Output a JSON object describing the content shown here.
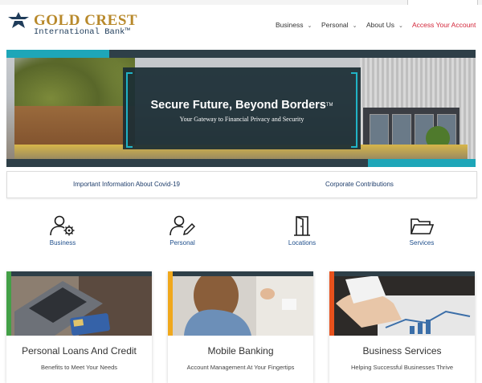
{
  "brand": {
    "name": "GOLD CREST",
    "subtitle": "International Bank™",
    "gold": "#b8892b",
    "navy": "#1f3c5a"
  },
  "nav": {
    "items": [
      {
        "label": "Business",
        "icon": "chevron-down-icon"
      },
      {
        "label": "Personal",
        "icon": "chevron-down-icon"
      },
      {
        "label": "About Us",
        "icon": "chevron-down-icon"
      }
    ],
    "cta": "Access Your Account",
    "cta_color": "#d3263a"
  },
  "hero": {
    "title": "Secure Future, Beyond Borders",
    "title_mark": "TM",
    "subtitle": "Your Gateway to Financial Privacy and Security",
    "accent": "#1ea6b8"
  },
  "info_links": [
    "Important Information About Covid-19",
    "Corporate Contributions"
  ],
  "quick_links": [
    {
      "label": "Business",
      "icon": "user-gear-icon"
    },
    {
      "label": "Personal",
      "icon": "user-edit-icon"
    },
    {
      "label": "Locations",
      "icon": "door-icon"
    },
    {
      "label": "Services",
      "icon": "folder-open-icon"
    }
  ],
  "cards": [
    {
      "title": "Personal Loans And Credit",
      "subtitle": "Benefits to Meet Your Needs",
      "accent": "#43a047"
    },
    {
      "title": "Mobile Banking",
      "subtitle": "Account Management At Your Fingertips",
      "accent": "#f0a81c"
    },
    {
      "title": "Business Services",
      "subtitle": "Helping Successful Businesses Thrive",
      "accent": "#e8511c"
    }
  ]
}
